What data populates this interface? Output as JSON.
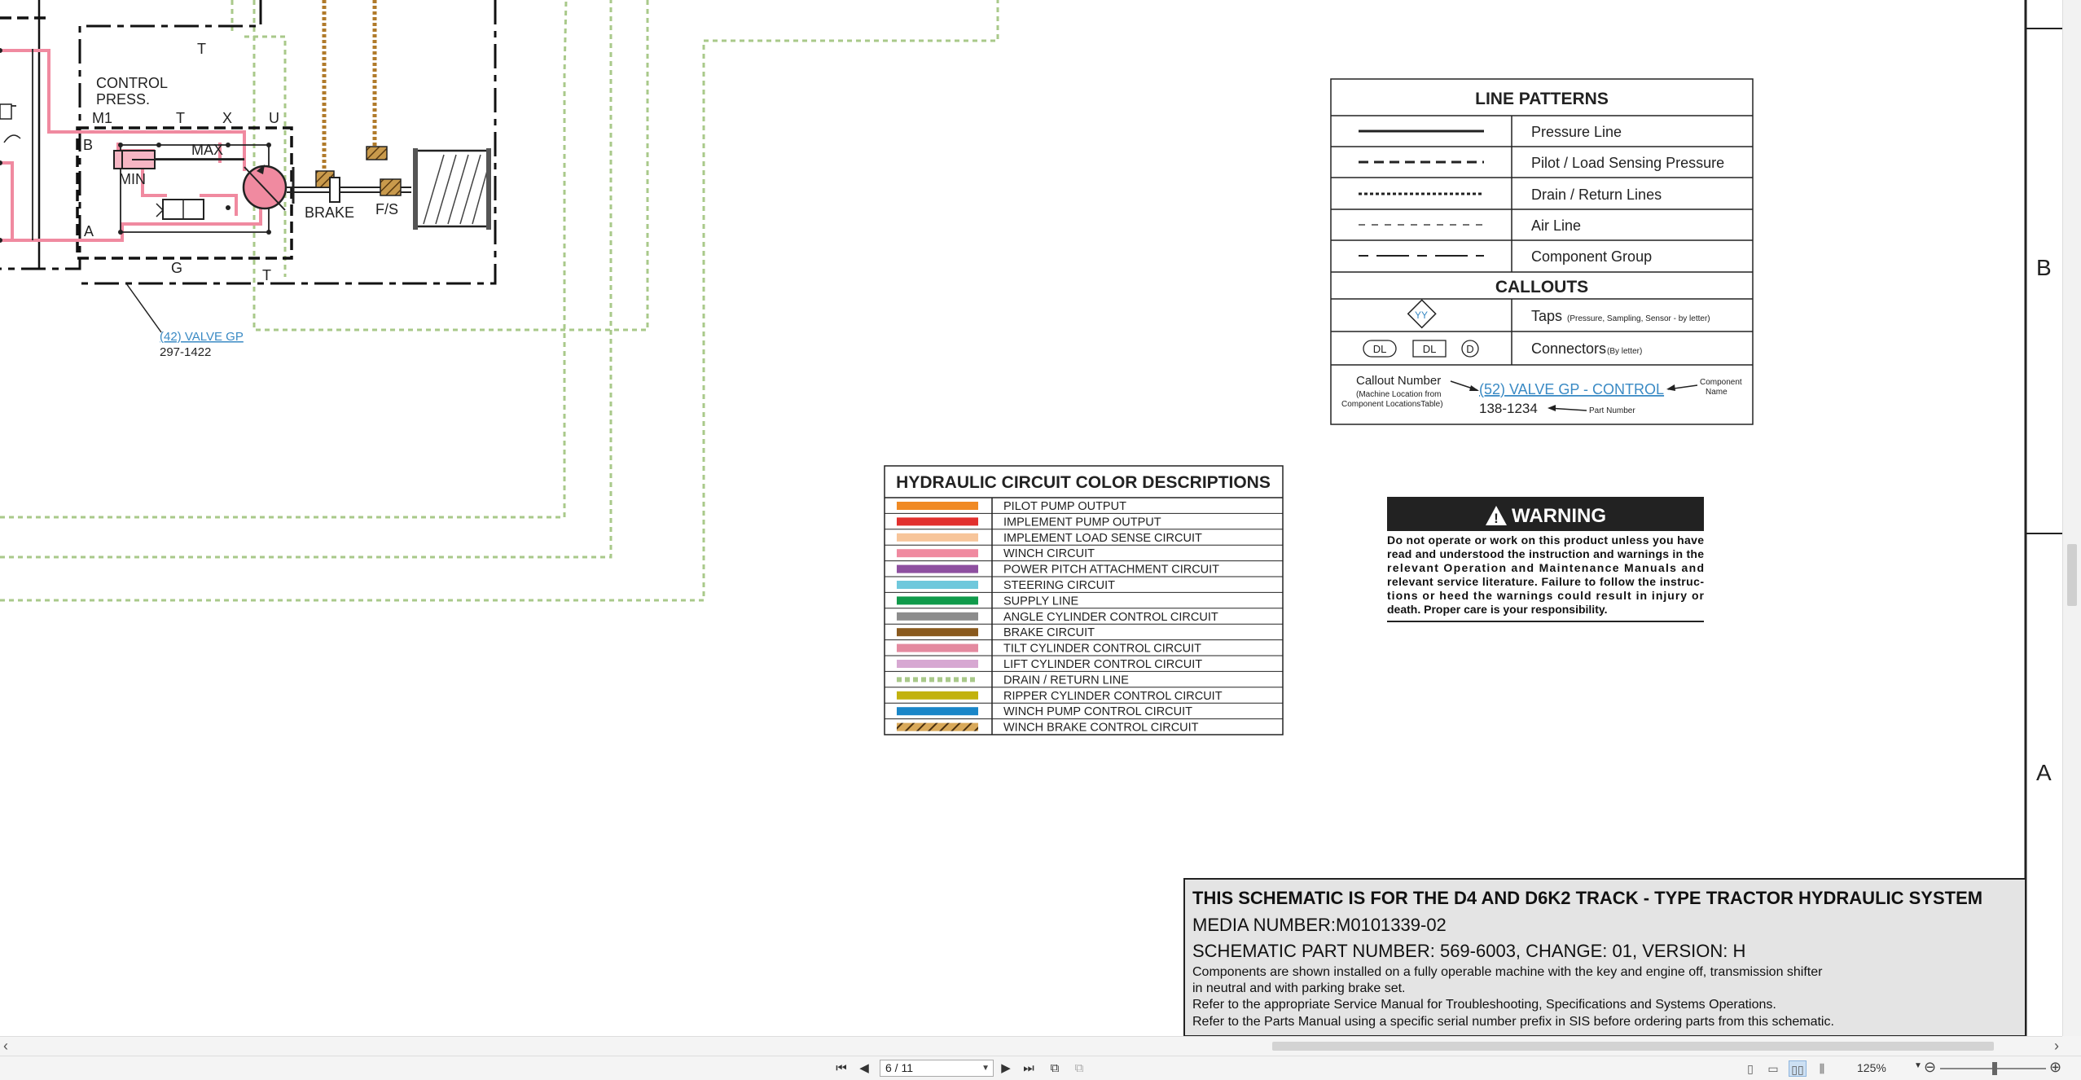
{
  "schematic": {
    "labels": {
      "control_press": [
        "CONTROL",
        "PRESS."
      ],
      "m1": "M1",
      "t_top_left": "T",
      "t_port": "T",
      "x_port": "X",
      "u_port": "U",
      "b_port": "B",
      "a_port": "A",
      "g_port": "G",
      "t_bottom": "T",
      "min": "MIN",
      "max": "MAX",
      "brake": "BRAKE",
      "fs": "F/S",
      "valve_callout": "(42) VALVE GP",
      "valve_part": "297-1422"
    },
    "zone_markers": [
      "B",
      "A"
    ]
  },
  "line_patterns": {
    "title": "LINE PATTERNS",
    "rows": [
      {
        "style": "solid",
        "label": "Pressure Line"
      },
      {
        "style": "dash-heavy",
        "label": "Pilot / Load Sensing Pressure"
      },
      {
        "style": "dotted-heavy",
        "label": "Drain / Return Lines"
      },
      {
        "style": "dash-light",
        "label": "Air Line"
      },
      {
        "style": "long-short",
        "label": "Component Group"
      }
    ],
    "callouts_title": "CALLOUTS",
    "taps": {
      "symbol": "YY",
      "label": "Taps",
      "note": "(Pressure, Sampling, Sensor - by letter)"
    },
    "connectors": {
      "symbols": [
        "DL",
        "DL",
        "D"
      ],
      "label": "Connectors",
      "note": "(By letter)"
    },
    "callout_example": {
      "callout_number": "Callout Number",
      "callout_note": [
        "(Machine Location from",
        "Component LocationsTable)"
      ],
      "link": "(52) VALVE GP - CONTROL",
      "part": "138-1234",
      "component_name": [
        "Component",
        "Name"
      ],
      "part_number": "Part Number"
    }
  },
  "color_legend": {
    "title": "HYDRAULIC CIRCUIT COLOR DESCRIPTIONS",
    "items": [
      {
        "color": "#f08a24",
        "label": "PILOT PUMP OUTPUT"
      },
      {
        "color": "#e2302d",
        "label": "IMPLEMENT PUMP OUTPUT"
      },
      {
        "color": "#f7c59a",
        "label": "IMPLEMENT LOAD SENSE CIRCUIT"
      },
      {
        "color": "#f08aa0",
        "label": "WINCH CIRCUIT"
      },
      {
        "color": "#8e4fa0",
        "label": "POWER PITCH ATTACHMENT CIRCUIT"
      },
      {
        "color": "#6fc8dc",
        "label": "STEERING CIRCUIT"
      },
      {
        "color": "#0f9a4a",
        "label": "SUPPLY LINE"
      },
      {
        "color": "#8c8c8c",
        "label": "ANGLE CYLINDER CONTROL CIRCUIT"
      },
      {
        "color": "#8a5a1e",
        "label": "BRAKE CIRCUIT"
      },
      {
        "color": "#e48aa0",
        "label": "TILT CYLINDER CONTROL CIRCUIT"
      },
      {
        "color": "#d7a8d2",
        "label": "LIFT CYLINDER CONTROL CIRCUIT"
      },
      {
        "color": "#a9c98a",
        "label": "DRAIN / RETURN LINE"
      },
      {
        "color": "#c2b20e",
        "label": "RIPPER CYLINDER CONTROL CIRCUIT"
      },
      {
        "color": "#1a86c8",
        "label": "WINCH PUMP CONTROL CIRCUIT"
      },
      {
        "color": "#b07a2a",
        "label": "WINCH BRAKE CONTROL CIRCUIT"
      }
    ]
  },
  "warning": {
    "title": "WARNING",
    "lines": [
      "Do not operate or work on this product unless you have",
      "read and understood the instruction and warnings in the",
      "relevant Operation and Maintenance Manuals and",
      "relevant service literature. Failure to follow the instruc-",
      "tions or heed the warnings could result in injury or",
      "death. Proper care is your responsibility."
    ]
  },
  "title_block": {
    "heading": "THIS SCHEMATIC IS FOR THE D4 AND D6K2 TRACK - TYPE TRACTOR HYDRAULIC SYSTEM",
    "media": "MEDIA NUMBER:M0101339-02",
    "part": "SCHEMATIC PART NUMBER: 569-6003, CHANGE: 01, VERSION: H",
    "notes": [
      "Components are shown installed on a fully operable machine with the key and engine off, transmission shifter",
      "in neutral and with parking brake set.",
      "Refer to the appropriate Service Manual for Troubleshooting, Specifications and Systems Operations.",
      "Refer to the Parts Manual using a specific serial number prefix in SIS before ordering parts from this schematic."
    ]
  },
  "toolbar": {
    "page_indicator": "6 / 11",
    "zoom": "125%"
  }
}
